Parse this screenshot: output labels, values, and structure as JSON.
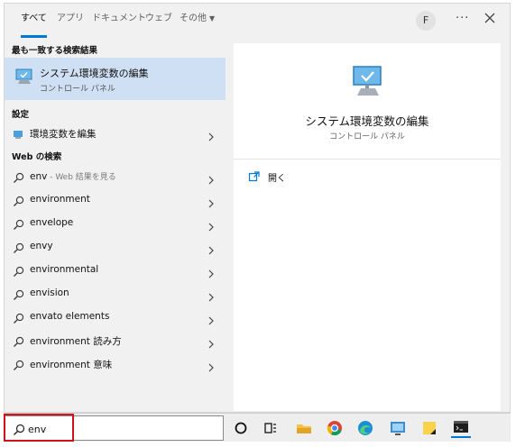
{
  "tabs": [
    {
      "label": "すべて",
      "active": true
    },
    {
      "label": "アプリ"
    },
    {
      "label": "ドキュメント"
    },
    {
      "label": "ウェブ"
    },
    {
      "label": "その他",
      "dropdown": true
    }
  ],
  "account": {
    "initial": "F"
  },
  "more_label": "···",
  "best_match": {
    "heading": "最も一致する検索結果",
    "title": "システム環境変数の編集",
    "subtitle": "コントロール パネル",
    "icon": "monitor-settings-icon"
  },
  "settings": {
    "heading": "設定",
    "items": [
      {
        "label": "環境変数を編集",
        "icon": "settings-app-icon"
      }
    ]
  },
  "web": {
    "heading": "Web の検索",
    "items": [
      {
        "label": "env",
        "suffix": " - Web 結果を見る"
      },
      {
        "label": "environment"
      },
      {
        "label": "envelope"
      },
      {
        "label": "envy"
      },
      {
        "label": "environmental"
      },
      {
        "label": "envision"
      },
      {
        "label": "envato elements"
      },
      {
        "label": "environment 読み方"
      },
      {
        "label": "environment 意味"
      }
    ]
  },
  "detail": {
    "title": "システム環境変数の編集",
    "subtitle": "コントロール パネル",
    "action": {
      "label": "開く",
      "icon": "open-icon"
    }
  },
  "search": {
    "value": "env"
  },
  "taskbar": {
    "icons": [
      "cortana-icon",
      "task-view-icon",
      "file-explorer-icon",
      "chrome-icon",
      "edge-icon",
      "remote-desktop-icon",
      "sticky-notes-icon",
      "terminal-icon"
    ],
    "active": "terminal-icon"
  },
  "colors": {
    "accent": "#0078d4",
    "selection": "#cfe0f4",
    "highlight_box": "#d0101b"
  }
}
